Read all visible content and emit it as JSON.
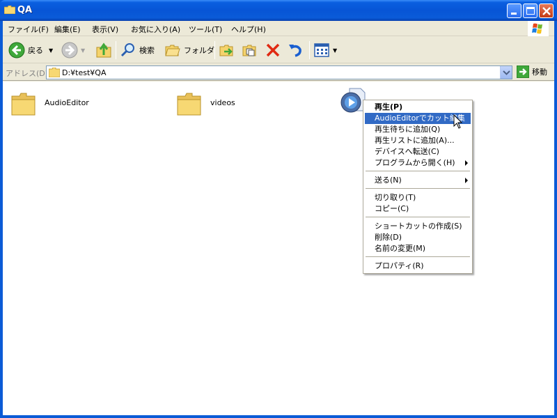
{
  "window": {
    "title": "QA"
  },
  "menubar": {
    "items": [
      "ファイル(F)",
      "編集(E)",
      "表示(V)",
      "お気に入り(A)",
      "ツール(T)",
      "ヘルプ(H)"
    ]
  },
  "toolbar": {
    "back_label": "戻る",
    "search_label": "検索",
    "folders_label": "フォルダ"
  },
  "address": {
    "label": "アドレス(D)",
    "value": "D:¥test¥QA",
    "go_label": "移動"
  },
  "files": [
    {
      "name": "AudioEditor",
      "type": "folder"
    },
    {
      "name": "videos",
      "type": "folder"
    },
    {
      "name": "",
      "type": "media"
    }
  ],
  "context_menu": {
    "items": [
      {
        "label": "再生(P)",
        "bold": true
      },
      {
        "label": "AudioEditorでカット編集",
        "highlighted": true
      },
      {
        "label": "再生待ちに追加(Q)"
      },
      {
        "label": "再生リストに追加(A)..."
      },
      {
        "label": "デバイスへ転送(C)"
      },
      {
        "label": "プログラムから開く(H)",
        "submenu": true
      },
      {
        "label": "送る(N)",
        "submenu": true
      },
      {
        "label": "切り取り(T)"
      },
      {
        "label": "コピー(C)"
      },
      {
        "label": "ショートカットの作成(S)"
      },
      {
        "label": "削除(D)"
      },
      {
        "label": "名前の変更(M)"
      },
      {
        "label": "プロパティ(R)"
      }
    ]
  },
  "colors": {
    "titlebar": "#0a5fe0",
    "highlight": "#316ac5",
    "folder": "#f5d36b"
  }
}
